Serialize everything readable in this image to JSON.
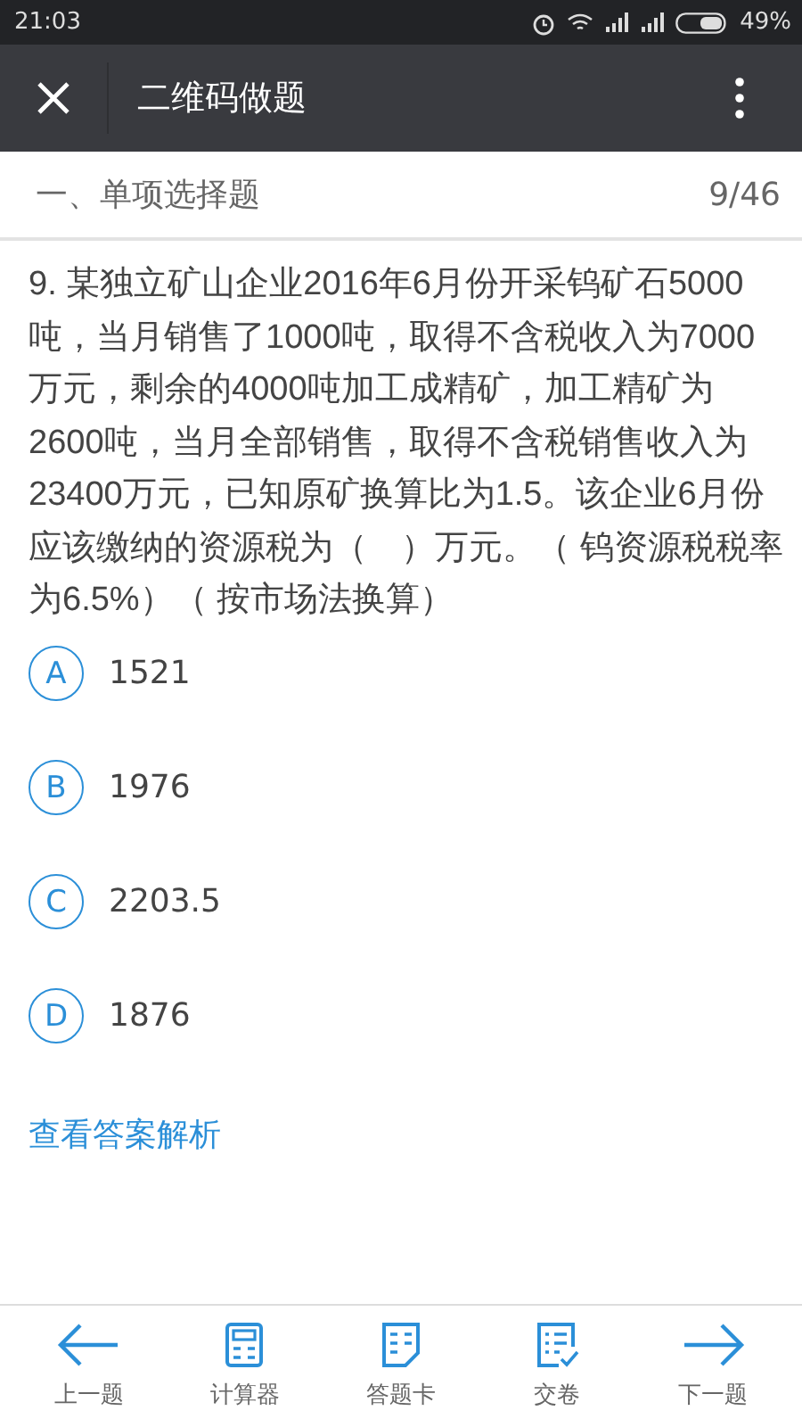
{
  "status_bar": {
    "time": "21:03",
    "battery": "49%"
  },
  "toolbar": {
    "title": "二维码做题"
  },
  "section": {
    "title": "一、单项选择题",
    "progress": "9/46"
  },
  "question": {
    "text": "9. 某独立矿山企业2016年6月份开采钨矿石5000吨，当月销售了1000吨，取得不含税收入为7000万元，剩余的4000吨加工成精矿，加工精矿为2600吨，当月全部销售，取得不含税销售收入为23400万元，已知原矿换算比为1.5。该企业6月份应该缴纳的资源税为（　）万元。（ 钨资源税税率为6.5%）（ 按市场法换算）"
  },
  "options": [
    {
      "letter": "A",
      "text": "1521"
    },
    {
      "letter": "B",
      "text": "1976"
    },
    {
      "letter": "C",
      "text": "2203.5"
    },
    {
      "letter": "D",
      "text": "1876"
    }
  ],
  "answer_link": "查看答案解析",
  "bottom_nav": [
    {
      "kind": "prev",
      "label": "上一题"
    },
    {
      "kind": "calculator",
      "label": "计算器"
    },
    {
      "kind": "card",
      "label": "答题卡"
    },
    {
      "kind": "submit",
      "label": "交卷"
    },
    {
      "kind": "next",
      "label": "下一题"
    }
  ]
}
